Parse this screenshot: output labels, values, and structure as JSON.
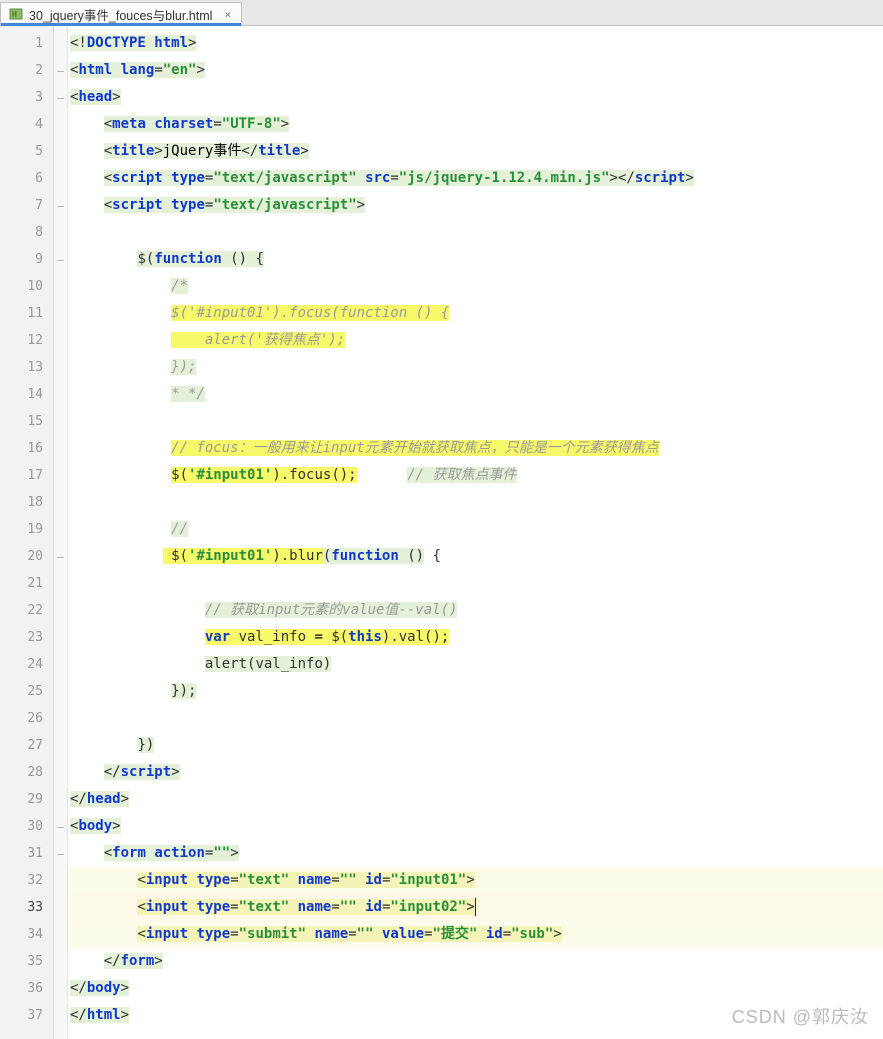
{
  "tab": {
    "filename": "30_jquery事件_fouces与blur.html",
    "close": "×"
  },
  "lines": {
    "l1": "1",
    "l2": "2",
    "l3": "3",
    "l4": "4",
    "l5": "5",
    "l6": "6",
    "l7": "7",
    "l8": "8",
    "l9": "9",
    "l10": "10",
    "l11": "11",
    "l12": "12",
    "l13": "13",
    "l14": "14",
    "l15": "15",
    "l16": "16",
    "l17": "17",
    "l18": "18",
    "l19": "19",
    "l20": "20",
    "l21": "21",
    "l22": "22",
    "l23": "23",
    "l24": "24",
    "l25": "25",
    "l26": "26",
    "l27": "27",
    "l28": "28",
    "l29": "29",
    "l30": "30",
    "l31": "31",
    "l32": "32",
    "l33": "33",
    "l34": "34",
    "l35": "35",
    "l36": "36",
    "l37": "37"
  },
  "c": {
    "doctype_open": "<!",
    "doctype_kw": "DOCTYPE ",
    "doctype_html": "html",
    "gt": ">",
    "html_open": "<",
    "html_tag": "html ",
    "lang_attr": "lang",
    "eq": "=",
    "lang_val": "\"en\"",
    "head_o": "<",
    "head": "head",
    "head_c": ">",
    "meta_o": "<",
    "meta": "meta ",
    "charset": "charset",
    "utf": "\"UTF-8\"",
    "title_o": "<",
    "title": "title",
    "title_c": ">",
    "title_text": "jQuery事件",
    "title_e": "</",
    "title2": "title",
    "script_o": "<",
    "script": "script ",
    "type": "type",
    "type_js": "\"text/javascript\"",
    "src": "src",
    "src_v": "\"js/jquery-1.12.4.min.js\"",
    "script_e": "</",
    "script2": "script",
    "jq": "$",
    "paren_o": "(",
    "func": "function ",
    "parens": "()",
    "brace_o": " {",
    "brace_c": "}",
    "cm_open": "/*",
    "cm_l11": "$('#input01').focus(function () {",
    "cm_l12": "    alert('获得焦点');",
    "cm_l13": "});",
    "cm_close": "* */",
    "cm_l16": "// focus：一般用来让input元素开始就获取焦点，只能是一个元素获得焦点",
    "l17_jq": "$(",
    "l17_sel": "'#input01'",
    "l17_close": ").",
    "l17_focus": "focus",
    "l17_end": "();",
    "l17_cmt": "// 获取焦点事件",
    "cm_l19": "//",
    "l20_pre": " ",
    "l20_jq": "$(",
    "l20_sel": "'#input01'",
    "l20_close": ").",
    "l20_blur": "blur",
    "l20_po": "(",
    "l20_func": "function ",
    "l20_p": "()",
    "l20_b": " {",
    "cm_l22": "// 获取input元素的value值--val()",
    "l23_var": "var ",
    "l23_name": "val_info",
    "l23_asn": " = ",
    "l23_jq": "$(",
    "l23_this": "this",
    "l23_close": ").",
    "l23_val": "val",
    "l23_end": "();",
    "l24_alert": "alert",
    "l24_p": "(",
    "l24_arg": "val_info",
    "l24_e": ")",
    "l25_end": "});",
    "l27_end": "})",
    "script_close": "</",
    "body_o": "<",
    "body": "body",
    "form_o": "<",
    "form": "form ",
    "action": "action",
    "action_v": "\"\"",
    "input_o": "<",
    "input": "input ",
    "type_attr": "type",
    "text_v": "\"text\"",
    "name_attr": "name",
    "name_v": "\"\"",
    "id_attr": "id",
    "id1": "\"input01\"",
    "id2": "\"input02\"",
    "submit_v": "\"submit\"",
    "value_attr": "value",
    "value_v": "\"提交\"",
    "id3": "\"sub\"",
    "form_e": "</",
    "form2": "form",
    "body_e": "</",
    "body2": "body",
    "html_e": "</",
    "html2": "html"
  },
  "watermark": "CSDN @郭庆汝"
}
